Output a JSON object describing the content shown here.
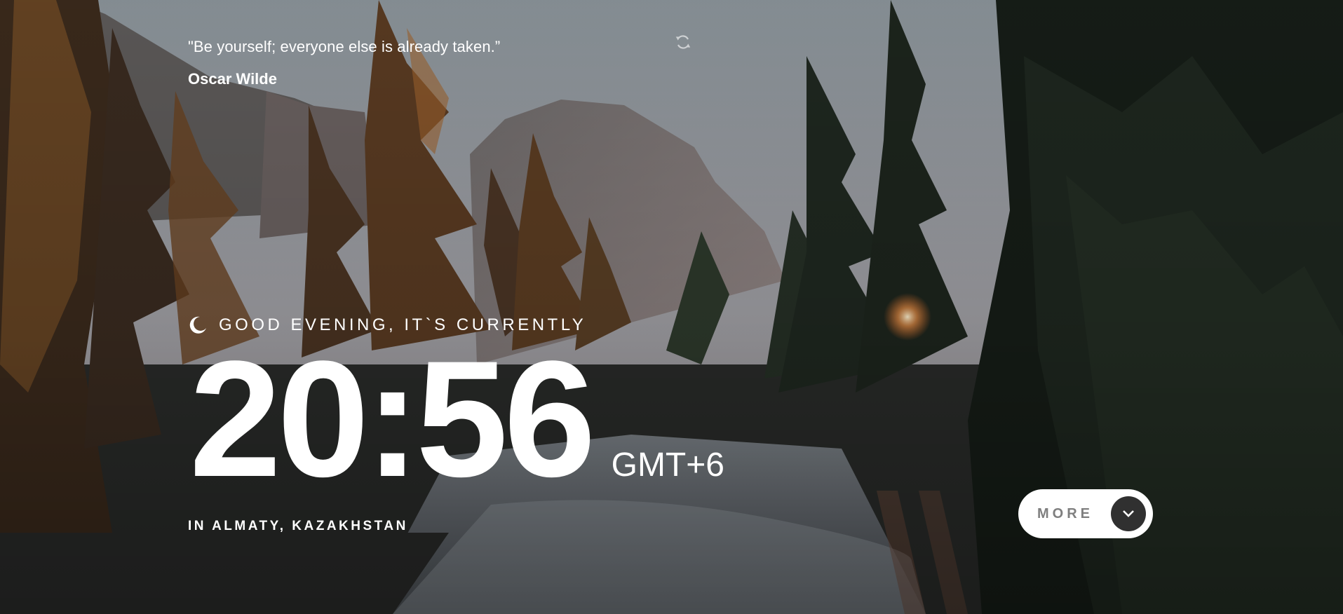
{
  "quote": {
    "text": "\"Be yourself; everyone else is already taken.”",
    "author": "Oscar Wilde",
    "refresh_icon": "refresh-icon"
  },
  "greeting": {
    "icon": "moon-icon",
    "text": "GOOD EVENING, IT`S CURRENTLY"
  },
  "clock": {
    "time": "20:56",
    "timezone": "GMT+6"
  },
  "location": {
    "text": "IN ALMATY, KAZAKHSTAN"
  },
  "more_button": {
    "label": "MORE",
    "icon": "chevron-down-icon"
  },
  "colors": {
    "text": "#ffffff",
    "button_bg": "#ffffff",
    "button_label": "#7f7f7f",
    "button_circle": "#303030"
  }
}
